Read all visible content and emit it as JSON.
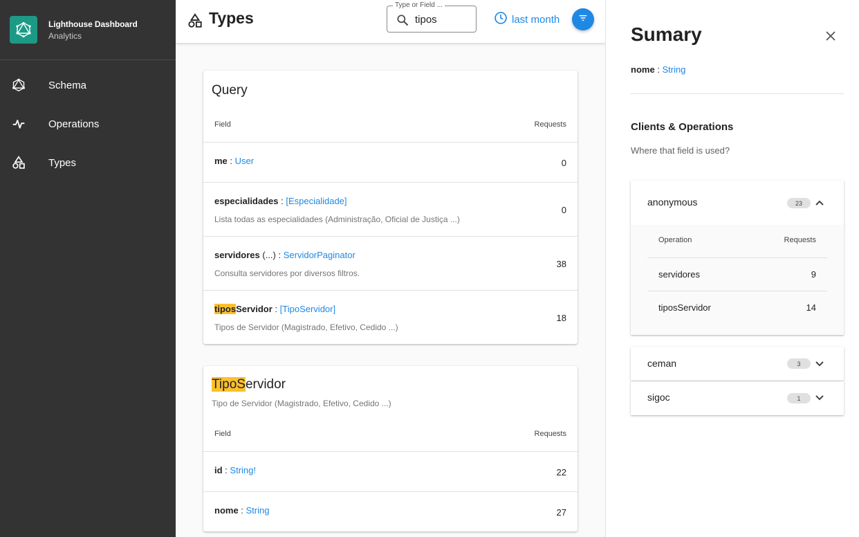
{
  "brand": {
    "title": "Lighthouse Dashboard",
    "subtitle": "Analytics",
    "logo_icon": "graphql-logo-icon",
    "accent": "#1d9a86"
  },
  "nav": [
    {
      "label": "Schema",
      "icon": "graphql-icon"
    },
    {
      "label": "Operations",
      "icon": "pulse-icon"
    },
    {
      "label": "Types",
      "icon": "shapes-icon"
    }
  ],
  "topbar": {
    "title": "Types",
    "search": {
      "legend": "Type or Field ...",
      "value": "tipos"
    },
    "period": "last month",
    "accent": "#1e88e5"
  },
  "query_card": {
    "title": "Query",
    "col_field": "Field",
    "col_requests": "Requests",
    "rows": [
      {
        "name": "me",
        "sep": " : ",
        "type": "User",
        "desc": "",
        "requests": "0"
      },
      {
        "name": "especialidades",
        "sep": " : ",
        "type": "[Especialidade]",
        "desc": "Lista todas as especialidades (Administração, Oficial de Justiça ...)",
        "requests": "0"
      },
      {
        "name": "servidores",
        "args": " (...)",
        "sep": " : ",
        "type": "ServidorPaginator",
        "desc": "Consulta servidores por diversos filtros.",
        "requests": "38"
      },
      {
        "name_hl": "tipos",
        "name_rest": "Servidor",
        "sep": " : ",
        "type": "[TipoServidor]",
        "desc": "Tipos de Servidor (Magistrado, Efetivo, Cedido ...)",
        "requests": "18"
      }
    ]
  },
  "tipo_card": {
    "title_hl": "TipoS",
    "title_rest": "ervidor",
    "desc": "Tipo de Servidor (Magistrado, Efetivo, Cedido ...)",
    "col_field": "Field",
    "col_requests": "Requests",
    "rows": [
      {
        "name": "id",
        "sep": " : ",
        "type": "String!",
        "requests": "22"
      },
      {
        "name": "nome",
        "sep": " : ",
        "type": "String",
        "requests": "27"
      }
    ]
  },
  "panel": {
    "title": "Sumary",
    "field_name": "nome",
    "field_sep": " : ",
    "field_type": "String",
    "section_title": "Clients & Operations",
    "section_sub": "Where that field is used?",
    "clients": [
      {
        "name": "anonymous",
        "count": "23",
        "expanded": true,
        "col_operation": "Operation",
        "col_requests": "Requests",
        "operations": [
          {
            "name": "servidores",
            "requests": "9"
          },
          {
            "name": "tiposServidor",
            "requests": "14"
          }
        ]
      },
      {
        "name": "ceman",
        "count": "3",
        "expanded": false
      },
      {
        "name": "sigoc",
        "count": "1",
        "expanded": false
      }
    ]
  }
}
